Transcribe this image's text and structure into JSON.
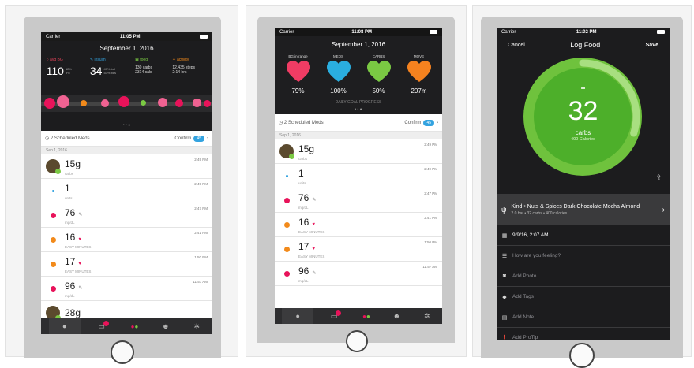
{
  "screen1": {
    "status": {
      "carrier": "Carrier",
      "time": "11:05 PM"
    },
    "date": "September 1, 2016",
    "stats": [
      {
        "label": "avg BG",
        "value": "110",
        "sub": "12%\n9%",
        "color": "#e8435a",
        "icon": "drop-icon"
      },
      {
        "label": "insulin",
        "value": "34",
        "sub": "47% bol\n53% bas",
        "color": "#33a3e0",
        "icon": "syringe-icon"
      },
      {
        "label": "food",
        "value": "",
        "sub": "130 carbs\n2314 cals",
        "color": "#7ac943",
        "icon": "food-icon"
      },
      {
        "label": "activity",
        "value": "",
        "sub": "12,435 steps\n2:14 hrs",
        "color": "#f28a1b",
        "icon": "runner-icon"
      }
    ],
    "scheduled": {
      "label": "2 Scheduled Meds",
      "confirm": "Confirm",
      "badge": "45"
    },
    "section_date": "Sep 1, 2016",
    "entries": [
      {
        "value": "15g",
        "unit": "carbs",
        "time": "2:49 PM",
        "type": "avatar",
        "color": "#7ac943"
      },
      {
        "value": "1",
        "unit": "units",
        "time": "2:49 PM",
        "type": "dot",
        "color": "#33a3e0"
      },
      {
        "value": "76",
        "unit": "mg/dL",
        "time": "2:47 PM",
        "type": "dot",
        "color": "#e8135a",
        "tag": "pencil"
      },
      {
        "value": "16",
        "unit": "EASY MINUTES",
        "time": "2:41 PM",
        "type": "dot",
        "color": "#f28a1b",
        "tag": "heart"
      },
      {
        "value": "17",
        "unit": "EASY MINUTES",
        "time": "1:50 PM",
        "type": "dot",
        "color": "#f28a1b",
        "tag": "heart"
      },
      {
        "value": "96",
        "unit": "mg/dL",
        "time": "11:57 AM",
        "type": "dot",
        "color": "#e8135a",
        "tag": "pencil"
      },
      {
        "value": "28g",
        "unit": "",
        "time": "",
        "type": "avatar",
        "color": "#7ac943"
      }
    ]
  },
  "screen2": {
    "status": {
      "carrier": "Carrier",
      "time": "11:08 PM"
    },
    "date": "September 1, 2016",
    "goals": [
      {
        "label": "BG in-range",
        "value": "79%",
        "color": "#f03c64"
      },
      {
        "label": "MEDS",
        "value": "100%",
        "color": "#2aaee0"
      },
      {
        "label": "CARBS",
        "value": "50%",
        "color": "#7ac943"
      },
      {
        "label": "MOVE",
        "value": "207m",
        "color": "#f5821f"
      }
    ],
    "goal_caption": "DAILY GOAL PROGRESS",
    "scheduled": {
      "label": "2 Scheduled Meds",
      "confirm": "Confirm",
      "badge": "45"
    },
    "section_date": "Sep 1, 2016",
    "entries": [
      {
        "value": "15g",
        "unit": "carbs",
        "time": "2:49 PM",
        "type": "avatar",
        "color": "#7ac943"
      },
      {
        "value": "1",
        "unit": "units",
        "time": "2:49 PM",
        "type": "dot",
        "color": "#33a3e0"
      },
      {
        "value": "76",
        "unit": "mg/dL",
        "time": "2:47 PM",
        "type": "dot",
        "color": "#e8135a",
        "tag": "pencil"
      },
      {
        "value": "16",
        "unit": "EASY MINUTES",
        "time": "2:41 PM",
        "type": "dot",
        "color": "#f28a1b",
        "tag": "heart"
      },
      {
        "value": "17",
        "unit": "EASY MINUTES",
        "time": "1:50 PM",
        "type": "dot",
        "color": "#f28a1b",
        "tag": "heart"
      },
      {
        "value": "96",
        "unit": "mg/dL",
        "time": "11:57 AM",
        "type": "dot",
        "color": "#e8135a",
        "tag": "pencil"
      }
    ]
  },
  "screen3": {
    "status": {
      "carrier": "Carrier",
      "time": "11:02 PM"
    },
    "nav": {
      "cancel": "Cancel",
      "title": "Log Food",
      "save": "Save"
    },
    "ring": {
      "value": "32",
      "unit": "carbs",
      "calories": "400 Calories",
      "progress": 0.3
    },
    "food": {
      "name": "Kind • Nuts & Spices Dark Chocolate Mocha Almond",
      "detail": "2.0 bar • 32 carbs • 400 calories"
    },
    "rows": [
      {
        "icon": "calendar-icon",
        "text": "9/9/16, 2:07 AM",
        "active": true
      },
      {
        "icon": "sliders-icon",
        "text": "How are you feeling?",
        "active": false
      },
      {
        "icon": "camera-icon",
        "text": "Add Photo",
        "active": false
      },
      {
        "icon": "tag-icon",
        "text": "Add Tags",
        "active": false
      },
      {
        "icon": "note-icon",
        "text": "Add Note",
        "active": false
      },
      {
        "icon": "info-icon",
        "text": "Add ProTip",
        "active": false
      }
    ]
  },
  "colors": {
    "accent": "#33a3e0",
    "green": "#7ac943",
    "dark": "#1c1c1e"
  }
}
